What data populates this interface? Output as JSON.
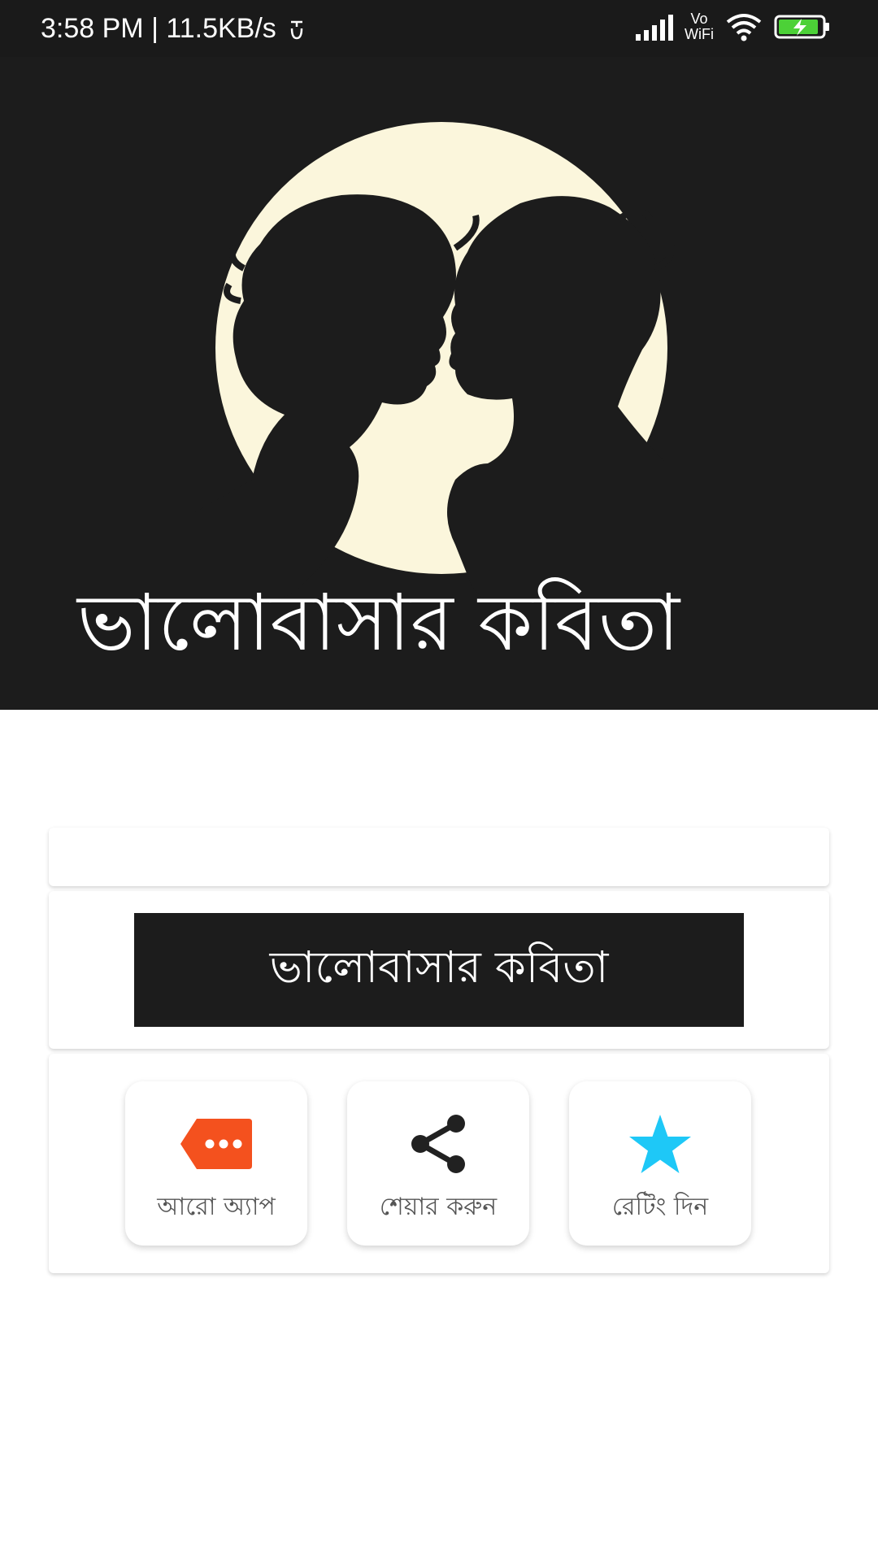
{
  "status_bar": {
    "time_speed": "3:58 PM | 11.5KB/s",
    "vowifi_line1": "Vo",
    "vowifi_line2": "WiFi",
    "icons": [
      "notification-icon",
      "signal-icon",
      "wifi-icon",
      "battery-charging-icon"
    ],
    "battery_color": "#4cd137"
  },
  "banner": {
    "title": "ভালোবাসার কবিতা",
    "moon_color": "#fbf6dc",
    "background": "#1c1c1c"
  },
  "main": {
    "title_button_label": "ভালোবাসার কবিতা",
    "actions": [
      {
        "label": "আরো অ্যাপ",
        "icon": "more-tag-icon",
        "color": "#f4511e"
      },
      {
        "label": "শেয়ার করুন",
        "icon": "share-icon",
        "color": "#212121"
      },
      {
        "label": "রেটিং দিন",
        "icon": "star-icon",
        "color": "#1ec8f7"
      }
    ]
  }
}
